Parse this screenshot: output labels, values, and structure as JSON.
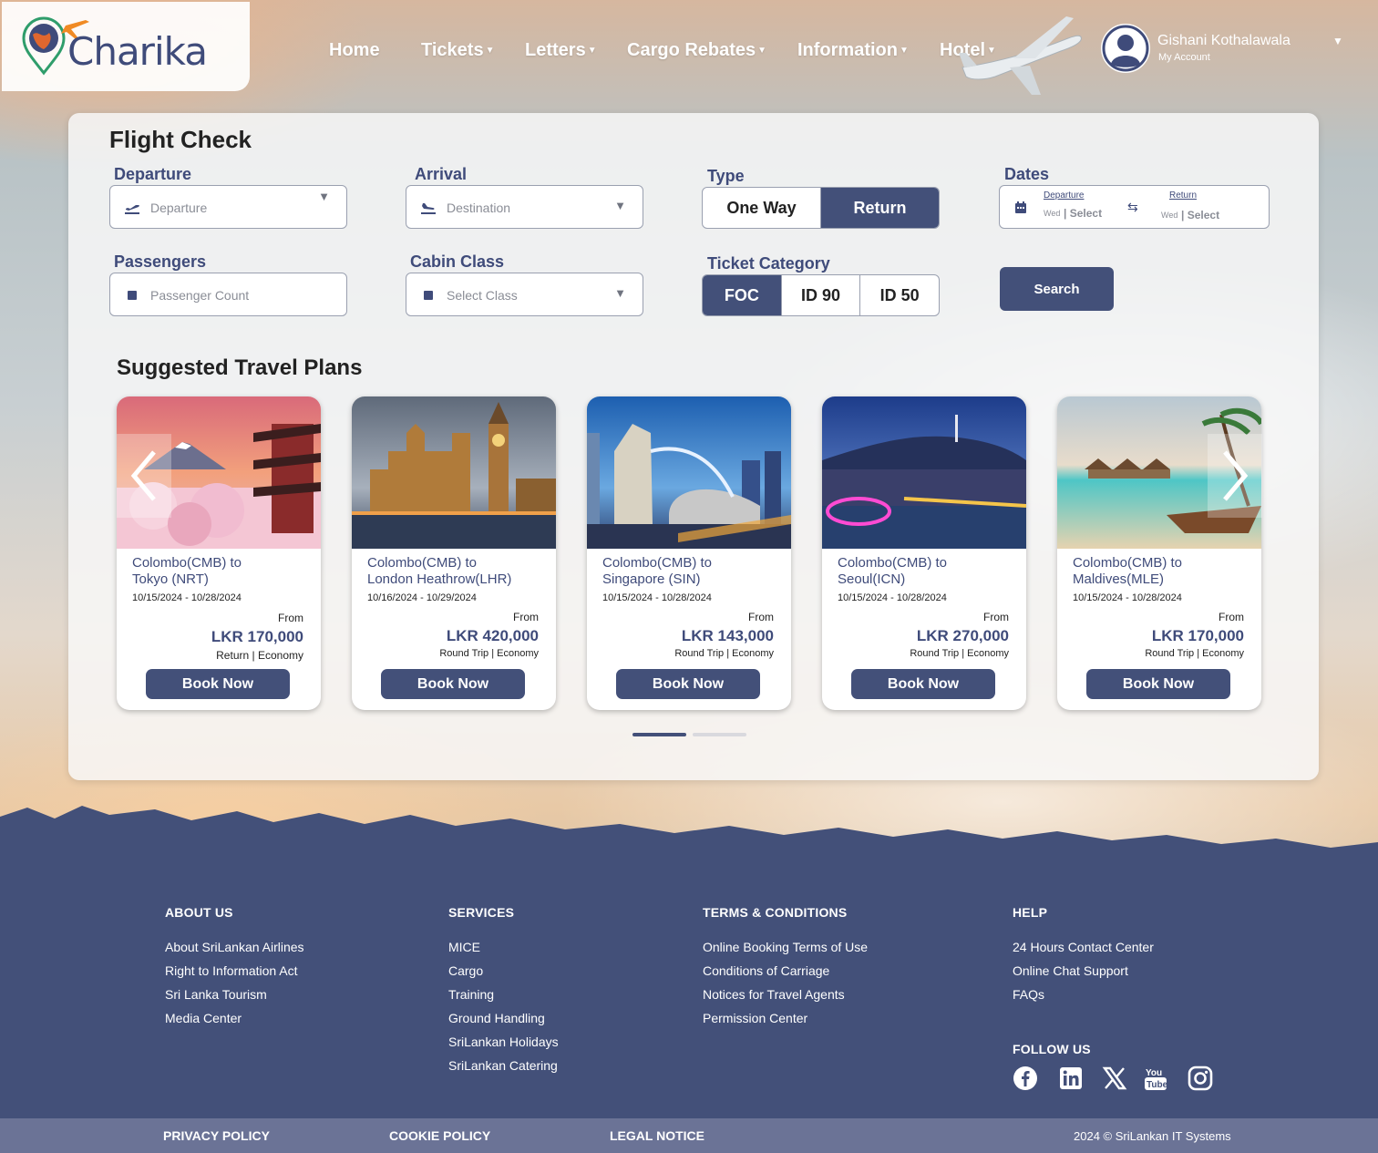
{
  "brand": {
    "name": "Charika"
  },
  "nav": {
    "home": "Home",
    "tickets": "Tickets",
    "letters": "Letters",
    "cargo": "Cargo Rebates",
    "information": "Information",
    "hotel": "Hotel"
  },
  "account": {
    "name": "Gishani Kothalawala",
    "sub": "My Account"
  },
  "flight_check": {
    "title": "Flight Check",
    "departure": {
      "label": "Departure",
      "placeholder": "Departure"
    },
    "arrival": {
      "label": "Arrival",
      "placeholder": "Destination"
    },
    "type": {
      "label": "Type",
      "options": [
        "One Way",
        "Return"
      ],
      "selected": "Return"
    },
    "dates": {
      "label": "Dates",
      "departure_label": "Departure",
      "return_label": "Return",
      "day": "Wed",
      "select": "Select"
    },
    "passengers": {
      "label": "Passengers",
      "placeholder": "Passenger Count"
    },
    "cabin": {
      "label": "Cabin Class",
      "placeholder": "Select Class"
    },
    "ticket_category": {
      "label": "Ticket Category",
      "options": [
        "FOC",
        "ID 90",
        "ID 50"
      ],
      "selected": "FOC"
    },
    "search_label": "Search"
  },
  "suggested": {
    "title": "Suggested Travel Plans",
    "book_label": "Book Now",
    "from_label": "From",
    "cards": [
      {
        "route1": "Colombo(CMB) to",
        "route2": "Tokyo (NRT)",
        "dates": "10/15/2024 - 10/28/2024",
        "price": "LKR 170,000",
        "trip": "Return",
        "cabin": "Economy"
      },
      {
        "route1": "Colombo(CMB) to",
        "route2": "London Heathrow(LHR)",
        "dates": "10/16/2024 - 10/29/2024",
        "price": "LKR 420,000",
        "trip": "Round Trip",
        "cabin": "Economy"
      },
      {
        "route1": "Colombo(CMB) to",
        "route2": "Singapore (SIN)",
        "dates": "10/15/2024 - 10/28/2024",
        "price": "LKR 143,000",
        "trip": "Round Trip",
        "cabin": "Economy"
      },
      {
        "route1": "Colombo(CMB) to",
        "route2": "Seoul(ICN)",
        "dates": "10/15/2024 - 10/28/2024",
        "price": "LKR 270,000",
        "trip": "Round Trip",
        "cabin": "Economy"
      },
      {
        "route1": "Colombo(CMB) to",
        "route2": "Maldives(MLE)",
        "dates": "10/15/2024 - 10/28/2024",
        "price": "LKR 170,000",
        "trip": "Round Trip",
        "cabin": "Economy"
      }
    ],
    "carousel_pages": 2,
    "active_page": 1
  },
  "footer": {
    "about": {
      "title": "ABOUT US",
      "links": [
        "About SriLankan Airlines",
        "Right to Information Act",
        "Sri Lanka Tourism",
        "Media Center"
      ]
    },
    "services": {
      "title": "SERVICES",
      "links": [
        "MICE",
        "Cargo",
        "Training",
        "Ground Handling",
        "SriLankan Holidays",
        "SriLankan Catering"
      ]
    },
    "terms": {
      "title": "TERMS & CONDITIONS",
      "links": [
        "Online Booking Terms of Use",
        "Conditions of Carriage",
        "Notices for Travel Agents",
        "Permission Center"
      ]
    },
    "help": {
      "title": "HELP",
      "links": [
        "24 Hours Contact Center",
        "Online Chat Support",
        "FAQs"
      ]
    },
    "follow": "FOLLOW US",
    "social": [
      "facebook-icon",
      "linkedin-icon",
      "x-icon",
      "youtube-icon",
      "instagram-icon"
    ]
  },
  "bottom": {
    "privacy": "PRIVACY POLICY",
    "cookie": "COOKIE POLICY",
    "legal": "LEGAL NOTICE",
    "copyright": "2024 © SriLankan IT Systems"
  },
  "colors": {
    "primary": "#435079",
    "accent": "#f08a24",
    "footer": "#435079",
    "bottom_bar": "#6b7396"
  }
}
